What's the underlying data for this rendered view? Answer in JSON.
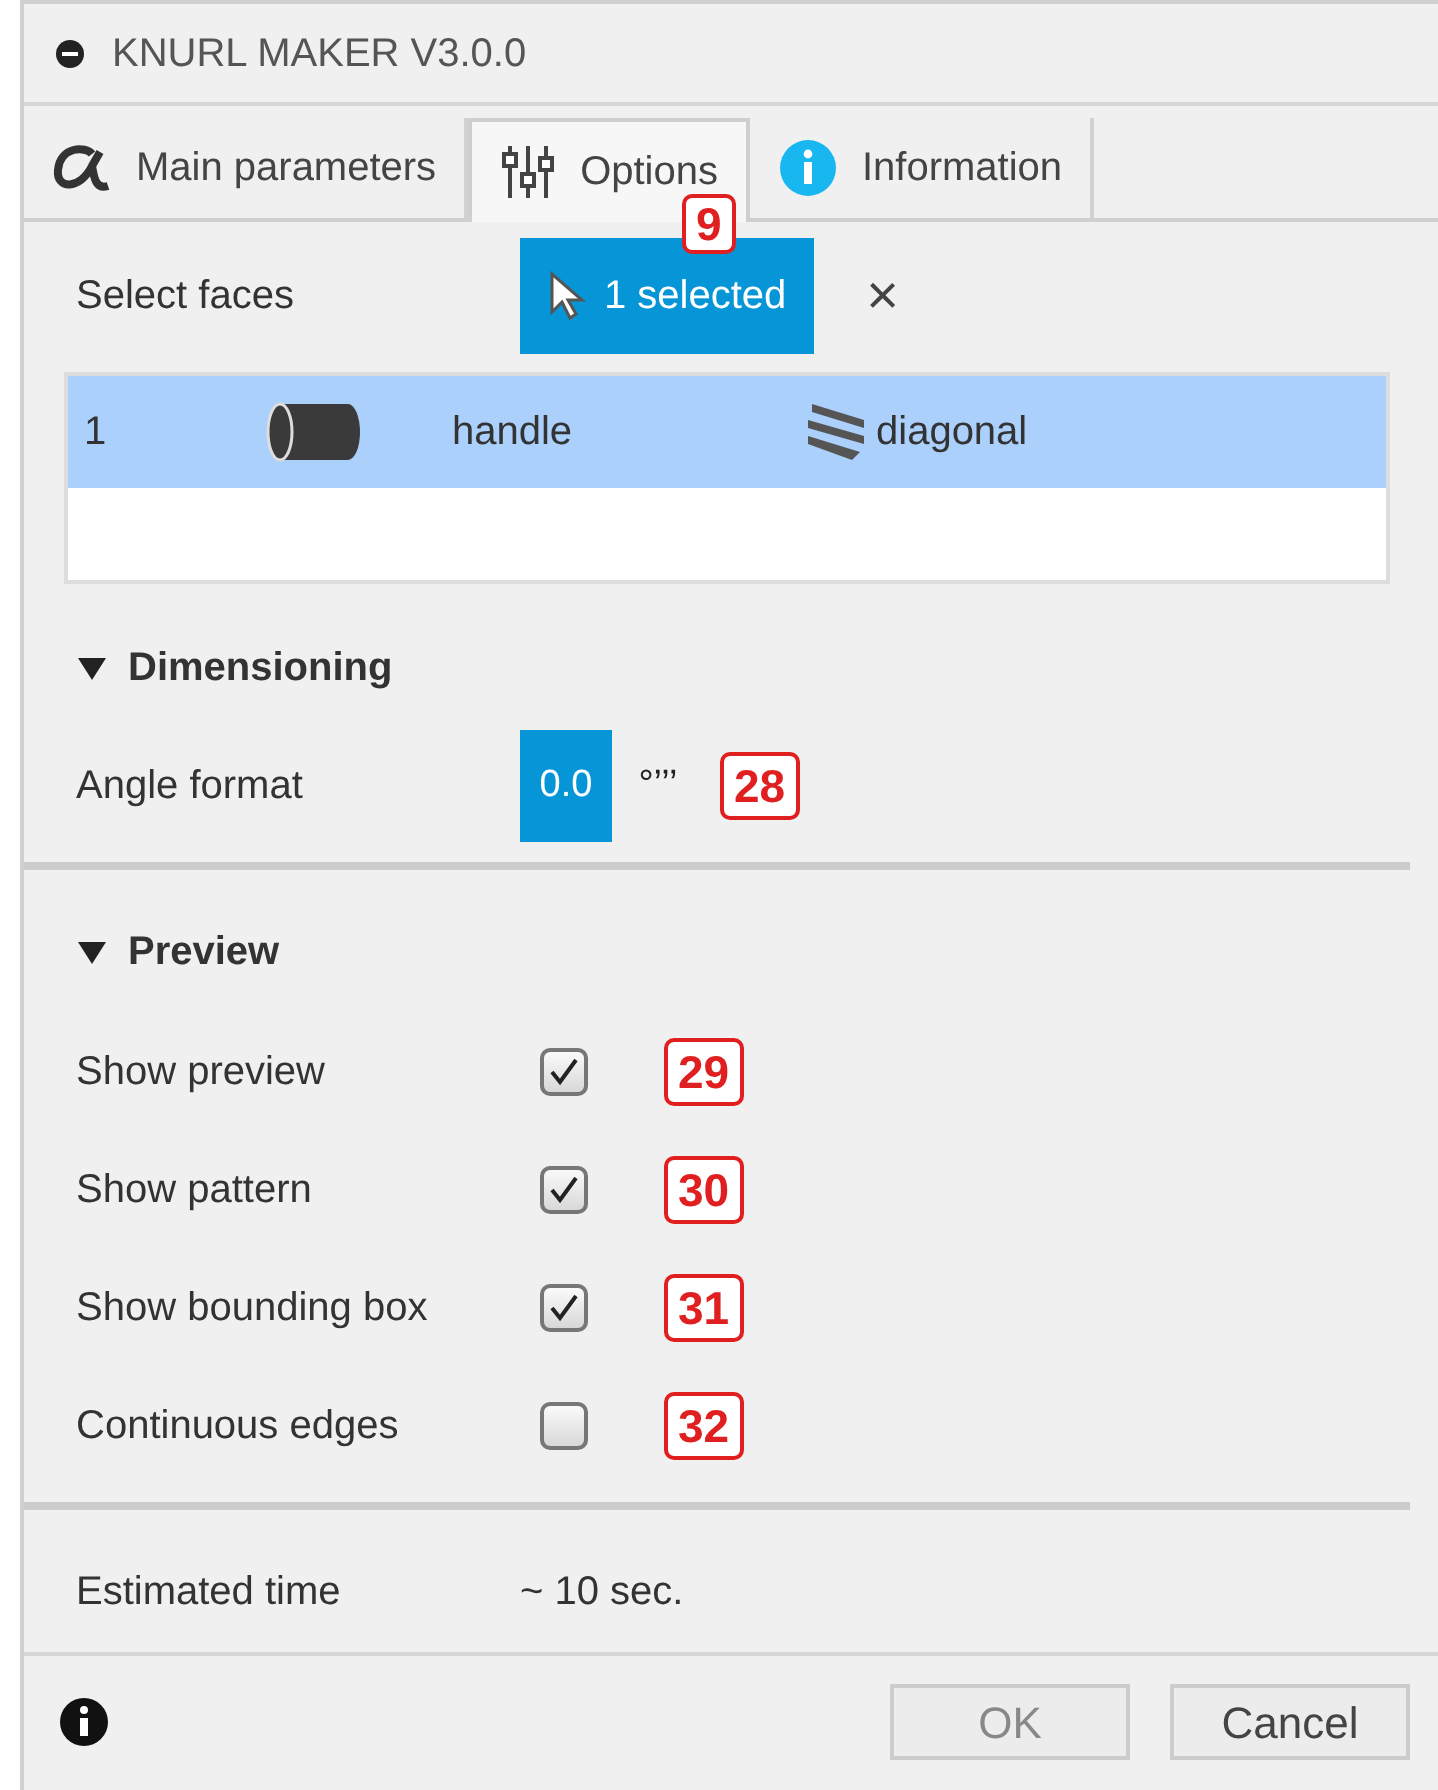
{
  "window": {
    "title": "KNURL MAKER V3.0.0"
  },
  "tabs": [
    {
      "label": "Main parameters",
      "selected": false
    },
    {
      "label": "Options",
      "selected": true,
      "callout": "9"
    },
    {
      "label": "Information",
      "selected": false
    }
  ],
  "select_faces": {
    "label": "Select faces",
    "button": "1 selected",
    "clear": "×"
  },
  "faces_table": {
    "rows": [
      {
        "number": "1",
        "name": "handle",
        "pattern": "diagonal",
        "selected": true
      }
    ]
  },
  "sections": [
    {
      "title": "Dimensioning",
      "expanded": true,
      "rows": [
        {
          "kind": "toggle",
          "label": "Angle format",
          "options": [
            {
              "label": "0.0",
              "selected": true
            },
            {
              "label": "°’’’",
              "selected": false
            }
          ],
          "callout": "28"
        }
      ]
    },
    {
      "title": "Preview",
      "expanded": true,
      "rows": [
        {
          "kind": "checkbox",
          "label": "Show preview",
          "checked": true,
          "callout": "29"
        },
        {
          "kind": "checkbox",
          "label": "Show pattern",
          "checked": true,
          "callout": "30"
        },
        {
          "kind": "checkbox",
          "label": "Show bounding box",
          "checked": true,
          "callout": "31"
        },
        {
          "kind": "checkbox",
          "label": "Continuous edges",
          "checked": false,
          "callout": "32"
        }
      ]
    }
  ],
  "estimate": {
    "label": "Estimated time",
    "value": "~ 10 sec."
  },
  "buttons": [
    {
      "label": "OK",
      "disabled": true
    },
    {
      "label": "Cancel",
      "disabled": false
    }
  ]
}
